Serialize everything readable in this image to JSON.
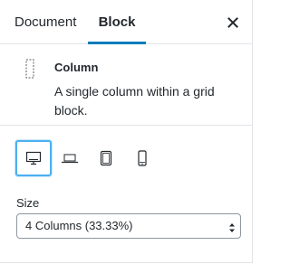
{
  "tabs": {
    "document_label": "Document",
    "block_label": "Block",
    "active": "Block"
  },
  "close_icon": "close-icon",
  "block_card": {
    "icon": "column-icon",
    "title": "Column",
    "description": "A single column within a grid block."
  },
  "devices": {
    "selected": "desktop",
    "items": [
      {
        "name": "desktop",
        "icon": "desktop-icon"
      },
      {
        "name": "laptop",
        "icon": "laptop-icon"
      },
      {
        "name": "tablet",
        "icon": "tablet-icon"
      },
      {
        "name": "mobile",
        "icon": "mobile-icon"
      }
    ]
  },
  "size": {
    "label": "Size",
    "selected_value": "4 Columns (33.33%)"
  },
  "colors": {
    "accent": "#007cba",
    "focus_ring": "#4cb0f0",
    "border": "#e2e4e7",
    "text": "#23282d"
  }
}
